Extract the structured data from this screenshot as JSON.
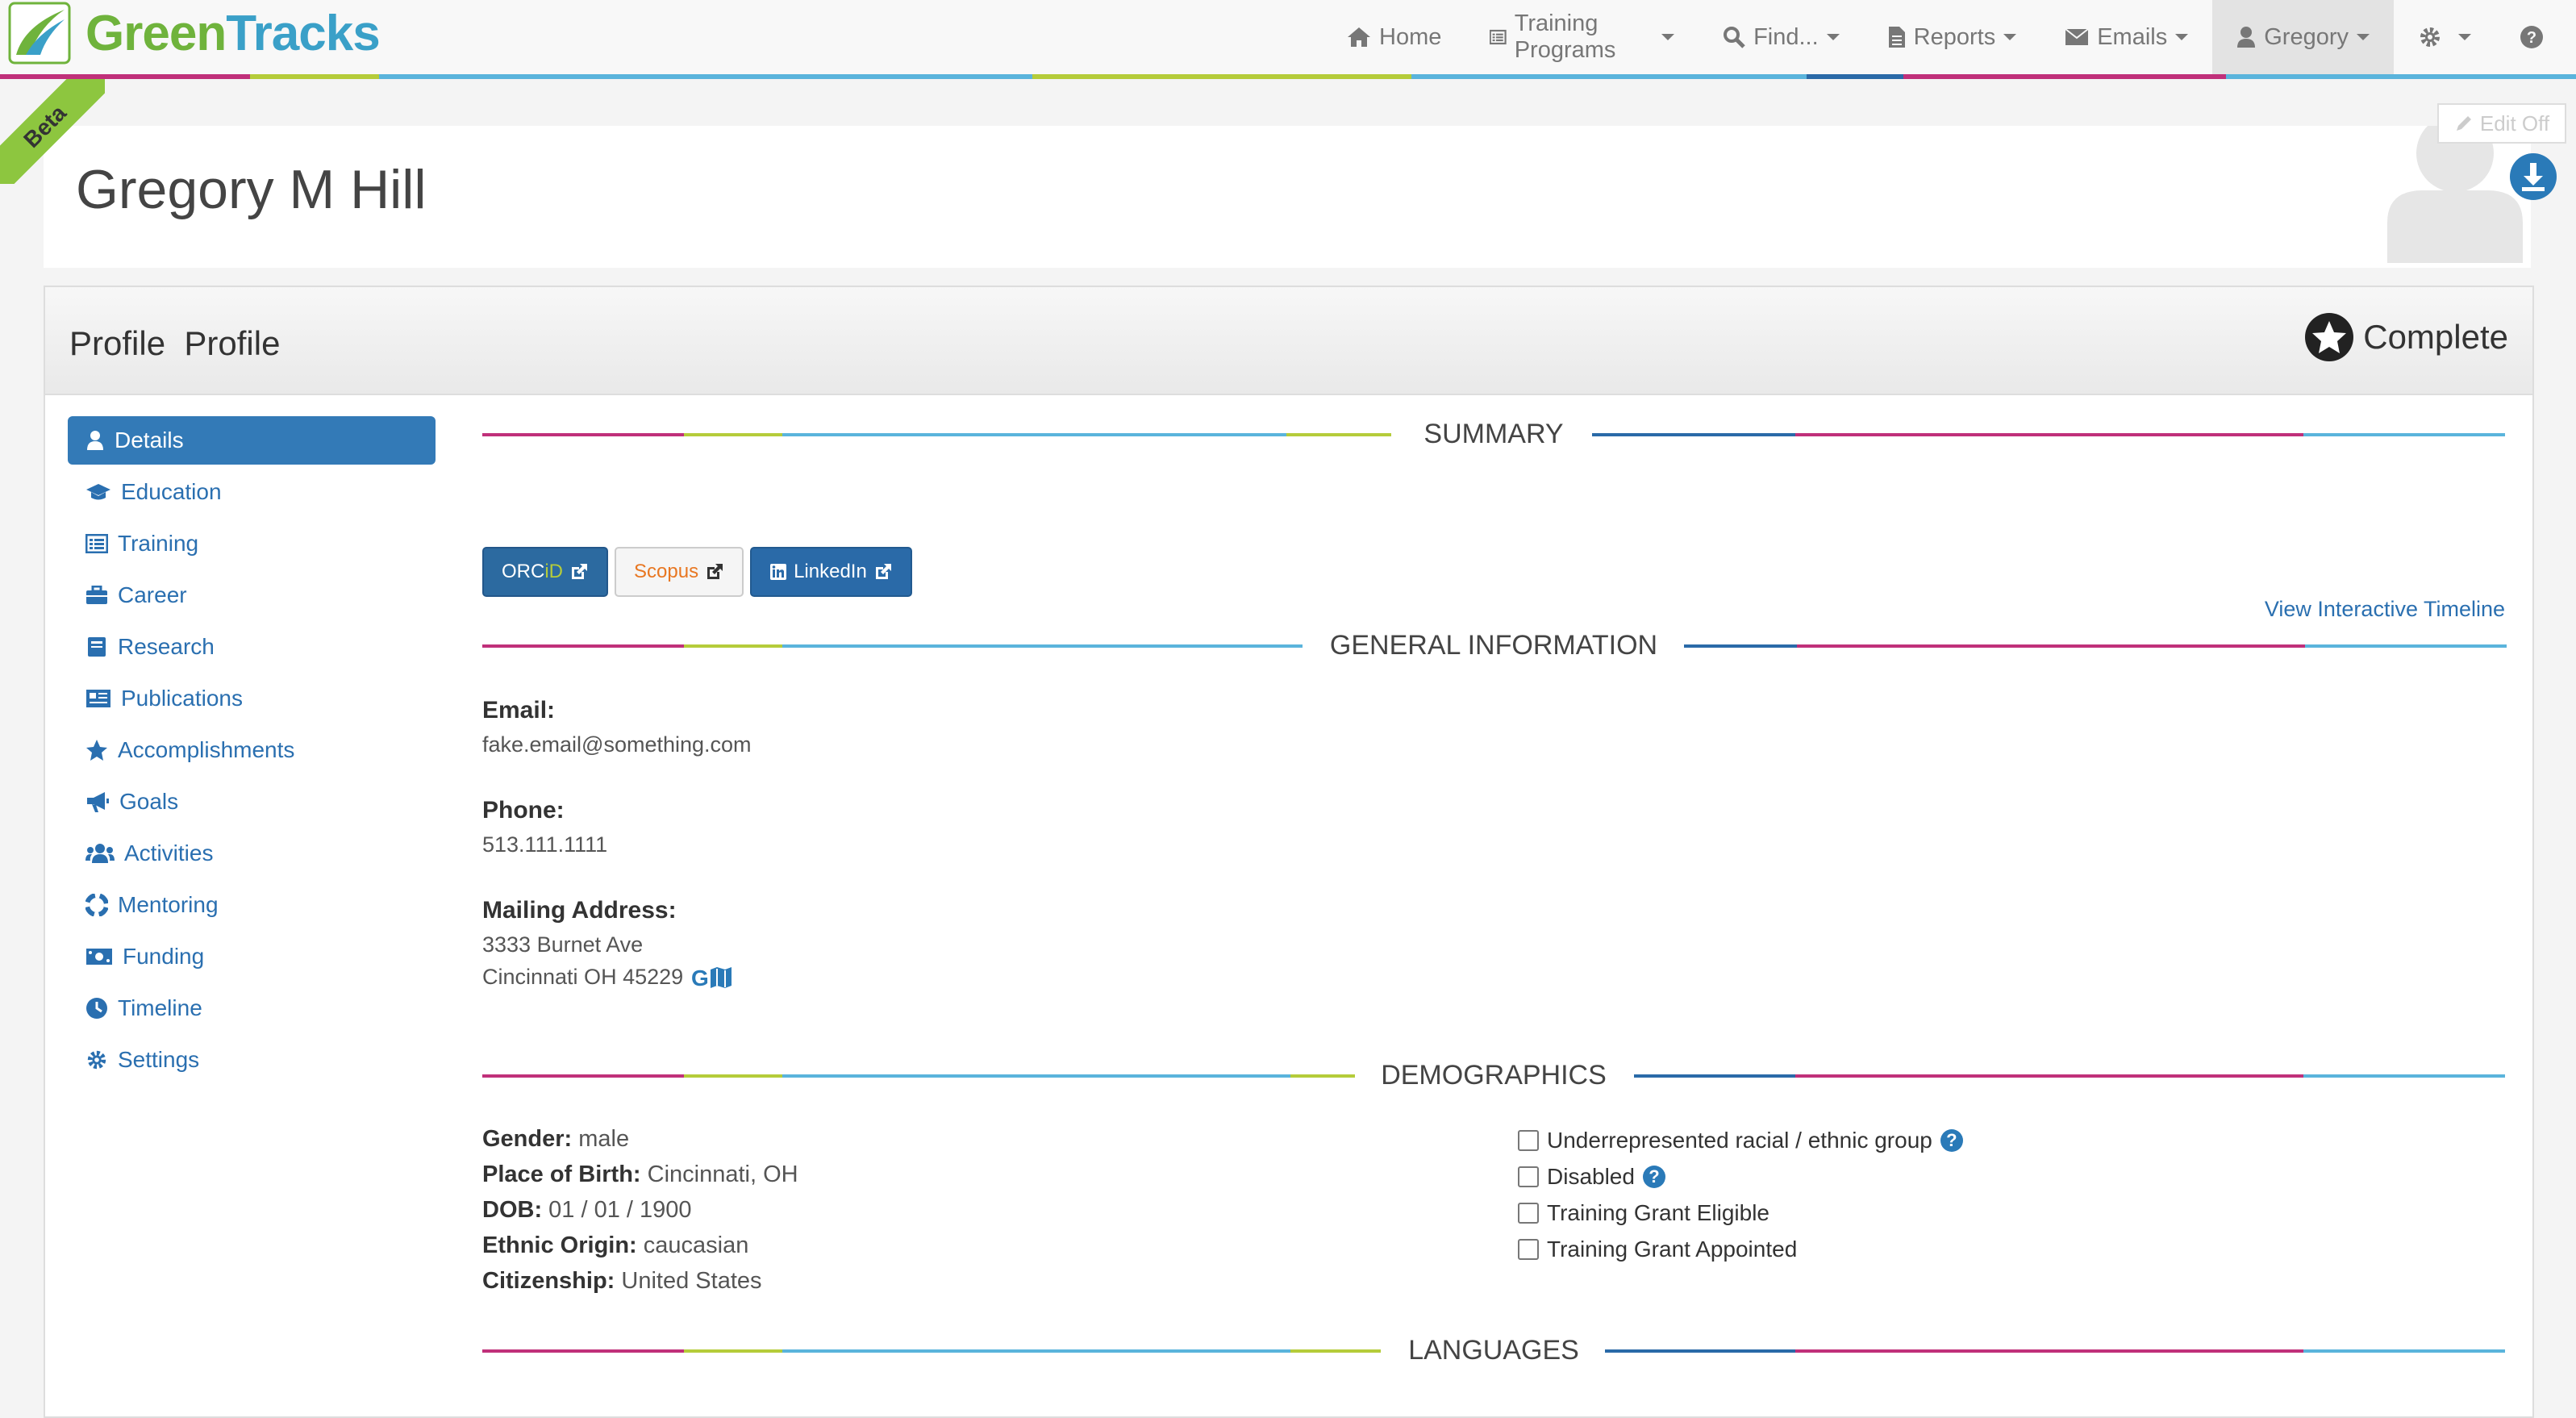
{
  "brand": {
    "name_part1": "Green",
    "name_part2": "Tracks"
  },
  "colors": {
    "brand_green": "#6fb33c",
    "brand_blue": "#3aa0c8",
    "link": "#2a6fb0",
    "active": "#337ab7",
    "stripe": [
      "#c0307a",
      "#b5cc3a",
      "#5ab4dc",
      "#2a6aa8"
    ]
  },
  "nav": {
    "home": "Home",
    "training_programs": "Training Programs",
    "find": "Find...",
    "reports": "Reports",
    "emails": "Emails",
    "user": "Gregory"
  },
  "ribbon": "Beta",
  "header": {
    "name": "Gregory M Hill",
    "edit_toggle": "Edit Off"
  },
  "panel": {
    "title": "Profile  Profile",
    "status": "Complete"
  },
  "sidenav": [
    {
      "label": "Details",
      "icon": "user-icon",
      "active": true
    },
    {
      "label": "Education",
      "icon": "graduation-cap-icon"
    },
    {
      "label": "Training",
      "icon": "list-icon"
    },
    {
      "label": "Career",
      "icon": "briefcase-icon"
    },
    {
      "label": "Research",
      "icon": "book-icon"
    },
    {
      "label": "Publications",
      "icon": "newspaper-icon"
    },
    {
      "label": "Accomplishments",
      "icon": "star-icon"
    },
    {
      "label": "Goals",
      "icon": "bullhorn-icon"
    },
    {
      "label": "Activities",
      "icon": "users-icon"
    },
    {
      "label": "Mentoring",
      "icon": "life-ring-icon"
    },
    {
      "label": "Funding",
      "icon": "money-icon"
    },
    {
      "label": "Timeline",
      "icon": "clock-icon"
    },
    {
      "label": "Settings",
      "icon": "gear-icon"
    }
  ],
  "sections": {
    "summary": "SUMMARY",
    "general": "GENERAL INFORMATION",
    "demographics": "DEMOGRAPHICS",
    "languages": "LANGUAGES"
  },
  "external": {
    "orcid_a": "ORC",
    "orcid_b": "iD",
    "scopus": "Scopus",
    "linkedin": "LinkedIn"
  },
  "timeline_link": "View Interactive Timeline",
  "general": {
    "email_label": "Email:",
    "email": "fake.email@something.com",
    "phone_label": "Phone:",
    "phone": "513.111.1111",
    "address_label": "Mailing Address:",
    "address_line1": "3333 Burnet Ave",
    "address_line2": "Cincinnati OH 45229"
  },
  "demographics": {
    "gender_label": "Gender:",
    "gender": "male",
    "birth_label": "Place of Birth:",
    "birth": "Cincinnati, OH",
    "dob_label": "DOB:",
    "dob": "01 / 01 / 1900",
    "ethnic_label": "Ethnic Origin:",
    "ethnic": "caucasian",
    "citizen_label": "Citizenship:",
    "citizen": "United States",
    "checkboxes": [
      {
        "label": "Underrepresented racial / ethnic group",
        "checked": false
      },
      {
        "label": "Disabled",
        "checked": false
      },
      {
        "label": "Training Grant Eligible",
        "checked": false
      },
      {
        "label": "Training Grant Appointed",
        "checked": false
      }
    ]
  }
}
